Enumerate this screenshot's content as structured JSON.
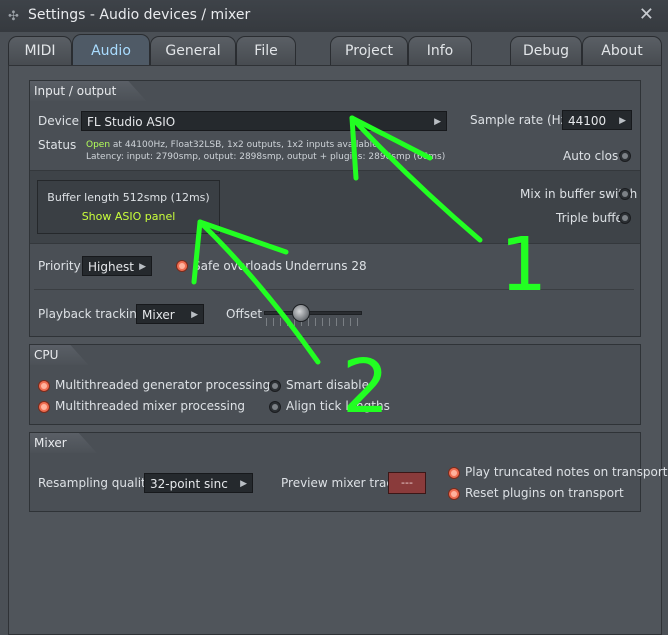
{
  "window": {
    "title": "Settings - Audio devices / mixer"
  },
  "tabs": [
    {
      "label": "MIDI"
    },
    {
      "label": "Audio"
    },
    {
      "label": "General"
    },
    {
      "label": "File"
    },
    {
      "label": "Project"
    },
    {
      "label": "Info"
    },
    {
      "label": "Debug"
    },
    {
      "label": "About"
    }
  ],
  "io": {
    "header": "Input / output",
    "device_label": "Device",
    "device_value": "FL Studio ASIO",
    "sample_rate_label": "Sample rate (Hz)",
    "sample_rate_value": "44100",
    "status_label": "Status",
    "status_open": "Open",
    "status_line1_rest": " at 44100Hz, Float32LSB, 1x2 outputs, 1x2 inputs available",
    "status_line2": "Latency: input: 2790smp, output: 2898smp, output + plugins: 2898smp (66ms)",
    "auto_close": "Auto close",
    "buffer_length": "Buffer length 512smp (12ms)",
    "show_asio": "Show ASIO panel",
    "mix_in_buffer": "Mix in buffer switch",
    "triple_buffer": "Triple buffer",
    "priority_label": "Priority",
    "priority_value": "Highest",
    "safe_overloads": "Safe overloads",
    "underruns": "Underruns 28",
    "playback_tracking_label": "Playback tracking",
    "playback_tracking_value": "Mixer",
    "offset_label": "Offset",
    "offset_level": 0.35
  },
  "cpu": {
    "header": "CPU",
    "multi_gen": "Multithreaded generator processing",
    "multi_mixer": "Multithreaded mixer processing",
    "smart_disable": "Smart disable",
    "align_tick": "Align tick lengths"
  },
  "mixer": {
    "header": "Mixer",
    "resampling_label": "Resampling quality",
    "resampling_value": "32-point sinc",
    "preview_label": "Preview mixer track",
    "preview_value": "---",
    "play_truncated": "Play truncated notes on transport",
    "reset_plugins": "Reset plugins on transport"
  },
  "annotations": {
    "one": "1",
    "two": "2"
  },
  "colors": {
    "annotation": "#22ff22",
    "accent_radio": "#ef6d51",
    "status_green": "#b3ff5a"
  }
}
